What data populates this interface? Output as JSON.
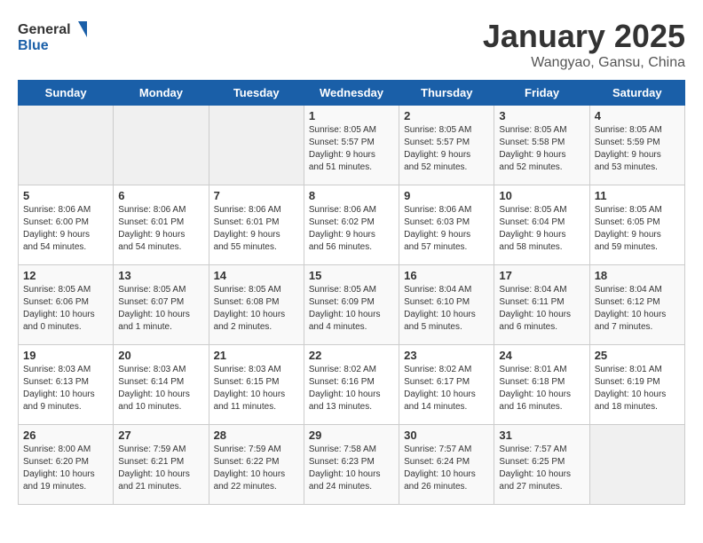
{
  "logo": {
    "line1": "General",
    "line2": "Blue"
  },
  "title": "January 2025",
  "subtitle": "Wangyao, Gansu, China",
  "headers": [
    "Sunday",
    "Monday",
    "Tuesday",
    "Wednesday",
    "Thursday",
    "Friday",
    "Saturday"
  ],
  "weeks": [
    [
      {
        "day": "",
        "info": ""
      },
      {
        "day": "",
        "info": ""
      },
      {
        "day": "",
        "info": ""
      },
      {
        "day": "1",
        "info": "Sunrise: 8:05 AM\nSunset: 5:57 PM\nDaylight: 9 hours\nand 51 minutes."
      },
      {
        "day": "2",
        "info": "Sunrise: 8:05 AM\nSunset: 5:57 PM\nDaylight: 9 hours\nand 52 minutes."
      },
      {
        "day": "3",
        "info": "Sunrise: 8:05 AM\nSunset: 5:58 PM\nDaylight: 9 hours\nand 52 minutes."
      },
      {
        "day": "4",
        "info": "Sunrise: 8:05 AM\nSunset: 5:59 PM\nDaylight: 9 hours\nand 53 minutes."
      }
    ],
    [
      {
        "day": "5",
        "info": "Sunrise: 8:06 AM\nSunset: 6:00 PM\nDaylight: 9 hours\nand 54 minutes."
      },
      {
        "day": "6",
        "info": "Sunrise: 8:06 AM\nSunset: 6:01 PM\nDaylight: 9 hours\nand 54 minutes."
      },
      {
        "day": "7",
        "info": "Sunrise: 8:06 AM\nSunset: 6:01 PM\nDaylight: 9 hours\nand 55 minutes."
      },
      {
        "day": "8",
        "info": "Sunrise: 8:06 AM\nSunset: 6:02 PM\nDaylight: 9 hours\nand 56 minutes."
      },
      {
        "day": "9",
        "info": "Sunrise: 8:06 AM\nSunset: 6:03 PM\nDaylight: 9 hours\nand 57 minutes."
      },
      {
        "day": "10",
        "info": "Sunrise: 8:05 AM\nSunset: 6:04 PM\nDaylight: 9 hours\nand 58 minutes."
      },
      {
        "day": "11",
        "info": "Sunrise: 8:05 AM\nSunset: 6:05 PM\nDaylight: 9 hours\nand 59 minutes."
      }
    ],
    [
      {
        "day": "12",
        "info": "Sunrise: 8:05 AM\nSunset: 6:06 PM\nDaylight: 10 hours\nand 0 minutes."
      },
      {
        "day": "13",
        "info": "Sunrise: 8:05 AM\nSunset: 6:07 PM\nDaylight: 10 hours\nand 1 minute."
      },
      {
        "day": "14",
        "info": "Sunrise: 8:05 AM\nSunset: 6:08 PM\nDaylight: 10 hours\nand 2 minutes."
      },
      {
        "day": "15",
        "info": "Sunrise: 8:05 AM\nSunset: 6:09 PM\nDaylight: 10 hours\nand 4 minutes."
      },
      {
        "day": "16",
        "info": "Sunrise: 8:04 AM\nSunset: 6:10 PM\nDaylight: 10 hours\nand 5 minutes."
      },
      {
        "day": "17",
        "info": "Sunrise: 8:04 AM\nSunset: 6:11 PM\nDaylight: 10 hours\nand 6 minutes."
      },
      {
        "day": "18",
        "info": "Sunrise: 8:04 AM\nSunset: 6:12 PM\nDaylight: 10 hours\nand 7 minutes."
      }
    ],
    [
      {
        "day": "19",
        "info": "Sunrise: 8:03 AM\nSunset: 6:13 PM\nDaylight: 10 hours\nand 9 minutes."
      },
      {
        "day": "20",
        "info": "Sunrise: 8:03 AM\nSunset: 6:14 PM\nDaylight: 10 hours\nand 10 minutes."
      },
      {
        "day": "21",
        "info": "Sunrise: 8:03 AM\nSunset: 6:15 PM\nDaylight: 10 hours\nand 11 minutes."
      },
      {
        "day": "22",
        "info": "Sunrise: 8:02 AM\nSunset: 6:16 PM\nDaylight: 10 hours\nand 13 minutes."
      },
      {
        "day": "23",
        "info": "Sunrise: 8:02 AM\nSunset: 6:17 PM\nDaylight: 10 hours\nand 14 minutes."
      },
      {
        "day": "24",
        "info": "Sunrise: 8:01 AM\nSunset: 6:18 PM\nDaylight: 10 hours\nand 16 minutes."
      },
      {
        "day": "25",
        "info": "Sunrise: 8:01 AM\nSunset: 6:19 PM\nDaylight: 10 hours\nand 18 minutes."
      }
    ],
    [
      {
        "day": "26",
        "info": "Sunrise: 8:00 AM\nSunset: 6:20 PM\nDaylight: 10 hours\nand 19 minutes."
      },
      {
        "day": "27",
        "info": "Sunrise: 7:59 AM\nSunset: 6:21 PM\nDaylight: 10 hours\nand 21 minutes."
      },
      {
        "day": "28",
        "info": "Sunrise: 7:59 AM\nSunset: 6:22 PM\nDaylight: 10 hours\nand 22 minutes."
      },
      {
        "day": "29",
        "info": "Sunrise: 7:58 AM\nSunset: 6:23 PM\nDaylight: 10 hours\nand 24 minutes."
      },
      {
        "day": "30",
        "info": "Sunrise: 7:57 AM\nSunset: 6:24 PM\nDaylight: 10 hours\nand 26 minutes."
      },
      {
        "day": "31",
        "info": "Sunrise: 7:57 AM\nSunset: 6:25 PM\nDaylight: 10 hours\nand 27 minutes."
      },
      {
        "day": "",
        "info": ""
      }
    ]
  ]
}
